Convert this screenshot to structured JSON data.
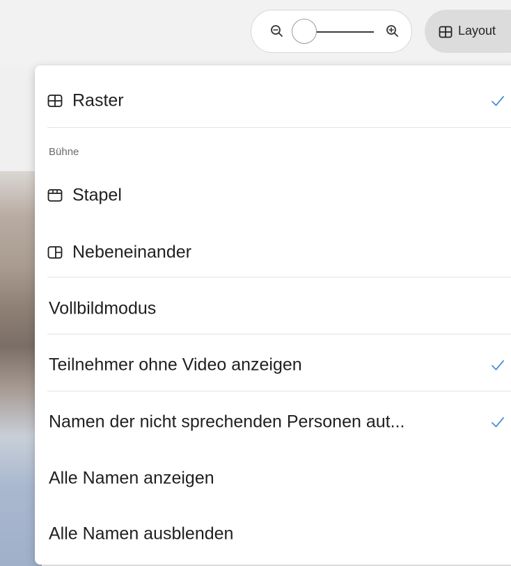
{
  "toolbar": {
    "zoom": {
      "zoom_out_icon": "zoom-out-icon",
      "zoom_in_icon": "zoom-in-icon"
    },
    "layout_button": {
      "label": "Layout",
      "icon": "grid-icon"
    }
  },
  "menu": {
    "items": [
      {
        "label": "Raster",
        "icon": "grid-icon",
        "checked": true
      },
      {
        "label": "Stapel",
        "icon": "stack-icon",
        "checked": false
      },
      {
        "label": "Nebeneinander",
        "icon": "side-by-side-icon",
        "checked": false
      },
      {
        "label": "Vollbildmodus",
        "checked": false
      },
      {
        "label": "Teilnehmer ohne Video anzeigen",
        "checked": true
      },
      {
        "label": "Namen der nicht sprechenden Personen aut...",
        "checked": true
      },
      {
        "label": "Alle Namen anzeigen",
        "checked": false
      },
      {
        "label": "Alle Namen ausblenden",
        "checked": false
      }
    ],
    "section_stage_label": "Bühne"
  },
  "colors": {
    "accent_check": "#4a8fd6",
    "menu_background": "#ffffff",
    "layout_button_background": "#dcdcdc"
  }
}
